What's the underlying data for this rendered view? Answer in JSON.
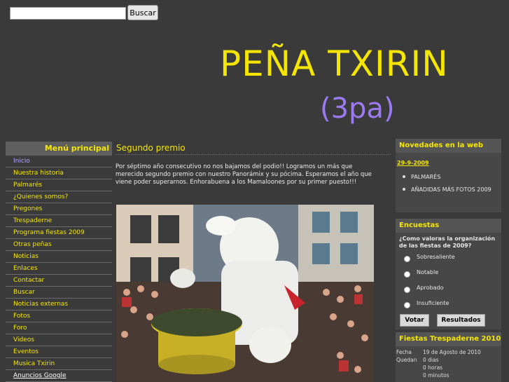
{
  "search": {
    "placeholder": "",
    "button_label": "Buscar"
  },
  "header": {
    "title": "PEÑA TXIRIN",
    "subtitle": "(3pa)"
  },
  "colors": {
    "accent": "#f4e600",
    "subtitle": "#9c7bf2",
    "background": "#3a3a3a"
  },
  "menu": {
    "title": "Menú principal",
    "items": [
      {
        "label": "Inicio"
      },
      {
        "label": "Nuestra historia"
      },
      {
        "label": "Palmarés"
      },
      {
        "label": "¿Quienes somos?"
      },
      {
        "label": "Pregones"
      },
      {
        "label": "Trespaderne"
      },
      {
        "label": "Programa fiestas 2009"
      },
      {
        "label": "Otras peñas"
      },
      {
        "label": "Noticias"
      },
      {
        "label": "Enlaces"
      },
      {
        "label": "Contactar"
      },
      {
        "label": "Buscar"
      },
      {
        "label": "Noticias externas"
      },
      {
        "label": "Fotos"
      },
      {
        "label": "Foro"
      },
      {
        "label": "Videos"
      },
      {
        "label": "Eventos"
      },
      {
        "label": "Musica Txirin"
      },
      {
        "label": "Anuncios Google"
      }
    ]
  },
  "post": {
    "title": "Segundo premio",
    "body": "Por séptimo año consecutivo no nos bajamos del podio!! Logramos un más que merecido segundo premio con nuestro Panorámix y su pócima. Esperamos el año que viene poder superarnos. Enhorabuena a los Mamaloones por su primer puesto!!!"
  },
  "news": {
    "title": "Novedades en la web",
    "date": "29-9-2009",
    "items": [
      "PALMARÉS",
      "AÑADIDAS MÁS FOTOS 2009"
    ]
  },
  "poll": {
    "title": "Encuestas",
    "question": "¿Como valoras la organización de las fiestas de 2009?",
    "options": [
      "Sobresaliente",
      "Notable",
      "Aprobado",
      "Insuficiente"
    ],
    "vote_label": "Votar",
    "results_label": "Resultados"
  },
  "fiestas": {
    "title": "Fiestas Trespaderne 2010",
    "fecha_label": "Fecha",
    "fecha_value": "19 de Agosto de 2010",
    "quedan_label": "Quedan",
    "dias": "0 dias",
    "horas": "0 horas",
    "minutos": "0 minutos"
  }
}
